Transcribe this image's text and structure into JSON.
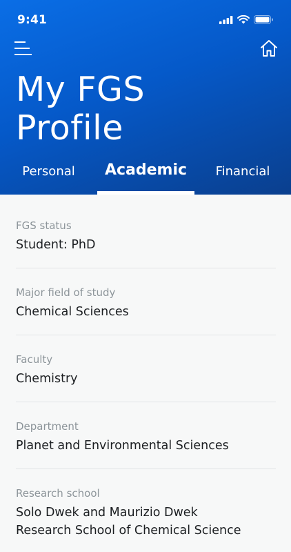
{
  "status_bar": {
    "time": "9:41",
    "icons": [
      "cellular-signal-icon",
      "wifi-icon",
      "battery-icon"
    ]
  },
  "header": {
    "title": "My FGS\nProfile",
    "menu_icon": "hamburger-menu-icon",
    "home_icon": "home-icon",
    "gradient_colors": [
      "#0a6ee6",
      "#0559c9",
      "#0a3f8e"
    ]
  },
  "tabs": [
    {
      "label": "Personal",
      "selected": false
    },
    {
      "label": "Academic",
      "selected": true
    },
    {
      "label": "Financial",
      "selected": false
    }
  ],
  "fields": [
    {
      "label": "FGS status",
      "value": "Student: PhD"
    },
    {
      "label": "Major field of study",
      "value": "Chemical Sciences"
    },
    {
      "label": "Faculty",
      "value": "Chemistry"
    },
    {
      "label": "Department",
      "value": "Planet and Environmental Sciences"
    },
    {
      "label": "Research school",
      "value": "Solo Dwek and Maurizio Dwek",
      "value_line2": "Research School of Chemical Science"
    }
  ],
  "colors": {
    "background": "#f7f8f8",
    "label": "#8d959a",
    "value": "#1c1f22",
    "divider": "#e1e4e6"
  }
}
